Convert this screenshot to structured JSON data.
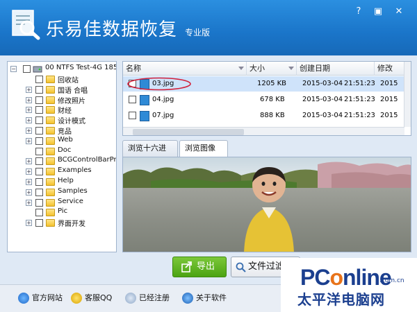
{
  "app": {
    "title": "乐易佳数据恢复",
    "edition": "专业版"
  },
  "window_buttons": {
    "help": "?",
    "restore": "▣",
    "close": "✕"
  },
  "tree": {
    "root_label": "00  NTFS  Test-4G  185",
    "items": [
      "回收站",
      "国语 合唱",
      "修改照片",
      "财经",
      "设计模式",
      "竞品",
      "Web",
      "Doc",
      "BCGControlBarPro I",
      "Examples",
      "Help",
      "Samples",
      "Service",
      "Pic",
      "界面开发"
    ]
  },
  "filelist": {
    "columns": [
      "名称",
      "大小",
      "创建日期",
      "修改"
    ],
    "rows": [
      {
        "name": "03.jpg",
        "size": "1205 KB",
        "date": "2015-03-04",
        "time": "21:51:23",
        "mod": "2015"
      },
      {
        "name": "04.jpg",
        "size": "678 KB",
        "date": "2015-03-04",
        "time": "21:51:23",
        "mod": "2015"
      },
      {
        "name": "07.jpg",
        "size": "888 KB",
        "date": "2015-03-04",
        "time": "21:51:23",
        "mod": "2015"
      }
    ]
  },
  "tabs": [
    "浏览十六进制",
    "浏览图像"
  ],
  "actions": {
    "export": "导出",
    "filter": "文件过滤"
  },
  "footer": {
    "links": [
      "官方网站",
      "客服QQ",
      "已经注册",
      "关于软件"
    ]
  },
  "watermark": {
    "brand_main": "PConline",
    "brand_domain": ".com.cn",
    "brand_cn": "太平洋电脑网"
  },
  "colors": {
    "title_bg": "#1a75c9",
    "accent_green": "#4ba313",
    "selection": "#cfe3fa",
    "brand_blue": "#1b3f8f",
    "brand_orange": "#e8731a"
  }
}
